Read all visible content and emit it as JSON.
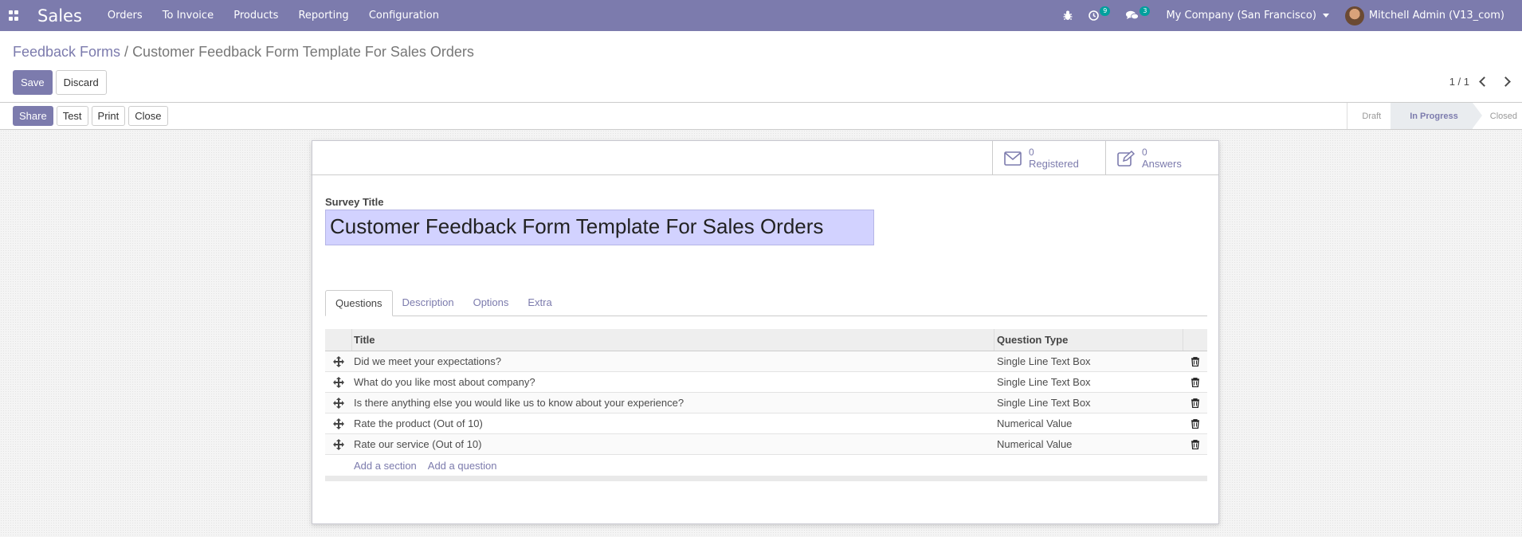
{
  "navbar": {
    "app_name": "Sales",
    "menu": [
      "Orders",
      "To Invoice",
      "Products",
      "Reporting",
      "Configuration"
    ],
    "activity_count": "9",
    "message_count": "3",
    "company": "My Company (San Francisco)",
    "user": "Mitchell Admin (V13_com)",
    "color": "#7c7bad"
  },
  "breadcrumb": {
    "parent": "Feedback Forms",
    "separator": "/",
    "current": "Customer Feedback Form Template For Sales Orders"
  },
  "control_panel": {
    "save_label": "Save",
    "discard_label": "Discard",
    "pager": "1 / 1"
  },
  "statusbar": {
    "buttons": [
      "Share",
      "Test",
      "Print",
      "Close"
    ],
    "stages": [
      "Draft",
      "In Progress",
      "Closed"
    ],
    "active_stage": "In Progress"
  },
  "stats": {
    "registered_count": "0",
    "registered_label": "Registered",
    "answers_count": "0",
    "answers_label": "Answers"
  },
  "form": {
    "title_label": "Survey Title",
    "title_value": "Customer Feedback Form Template For Sales Orders"
  },
  "tabs": [
    "Questions",
    "Description",
    "Options",
    "Extra"
  ],
  "table": {
    "columns": [
      "Title",
      "Question Type"
    ],
    "rows": [
      {
        "title": "Did we meet your expectations?",
        "type": "Single Line Text Box"
      },
      {
        "title": "What do you like most about company?",
        "type": "Single Line Text Box"
      },
      {
        "title": "Is there anything else you would like us to know about your experience?",
        "type": "Single Line Text Box"
      },
      {
        "title": "Rate the product (Out of 10)",
        "type": "Numerical Value"
      },
      {
        "title": "Rate our service (Out of 10)",
        "type": "Numerical Value"
      }
    ],
    "add_section": "Add a section",
    "add_question": "Add a question"
  }
}
